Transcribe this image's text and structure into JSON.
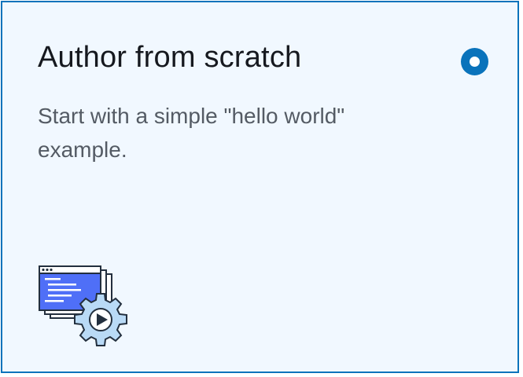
{
  "card": {
    "title": "Author from scratch",
    "description": "Start with a simple \"hello world\" example.",
    "selected": true,
    "illustration": "code-window-gear-icon"
  },
  "colors": {
    "selected_border": "#0a73bb",
    "card_background": "#f1f8ff",
    "radio": "#0a73bb",
    "title_text": "#16191f",
    "description_text": "#545b64",
    "illustration_window": "#4f6ff7",
    "illustration_gear": "#b9daf6"
  }
}
